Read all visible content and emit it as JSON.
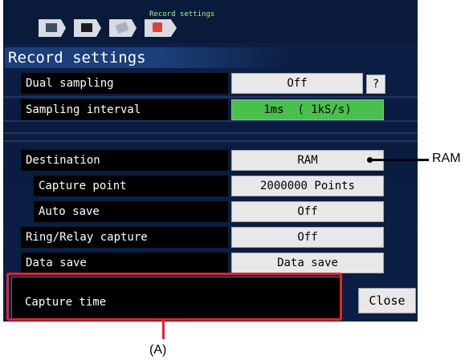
{
  "header": {
    "breadcrumb_title": "Record settings"
  },
  "page": {
    "title": "Record settings"
  },
  "rows": {
    "dual_sampling": {
      "label": "Dual sampling",
      "value": "Off",
      "help": "?"
    },
    "sampling_interval": {
      "label": "Sampling interval",
      "value": "1ms  ( 1kS/s)"
    },
    "destination": {
      "label": "Destination",
      "value": "RAM"
    },
    "capture_point": {
      "label": "Capture point",
      "value": "2000000 Points"
    },
    "auto_save": {
      "label": "Auto save",
      "value": "Off"
    },
    "ring_relay": {
      "label": "Ring/Relay capture",
      "value": "Off"
    },
    "data_save": {
      "label": "Data save",
      "value": "Data save"
    }
  },
  "message": {
    "text": "Capture time"
  },
  "buttons": {
    "close": "Close"
  },
  "annotations": {
    "ram": "RAM",
    "a": "(A)"
  },
  "colors": {
    "screen_bg": "#0b1f45",
    "green_value": "#48c04b",
    "highlight": "#e3242b"
  }
}
